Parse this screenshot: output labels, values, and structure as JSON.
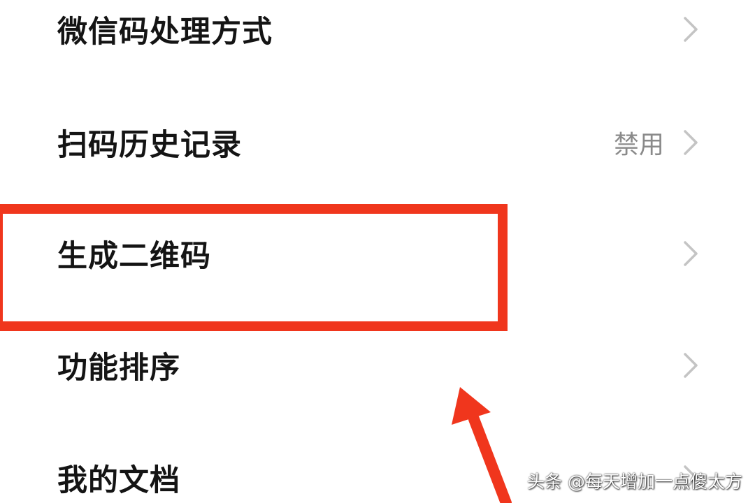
{
  "settings_list": {
    "items": [
      {
        "label": "微信码处理方式",
        "value": ""
      },
      {
        "label": "扫码历史记录",
        "value": "禁用"
      },
      {
        "label": "生成二维码",
        "value": ""
      },
      {
        "label": "功能排序",
        "value": ""
      },
      {
        "label": "我的文档",
        "value": ""
      }
    ]
  },
  "annotation": {
    "highlight_color": "#f0361d",
    "highlight_target": "生成二维码",
    "arrow_icon": "arrow-up-icon"
  },
  "watermark": {
    "text": "头条 @每天增加一点傻太方"
  },
  "colors": {
    "chevron": "#c4c4c4",
    "label": "#141414",
    "value": "#8a8a8a"
  }
}
